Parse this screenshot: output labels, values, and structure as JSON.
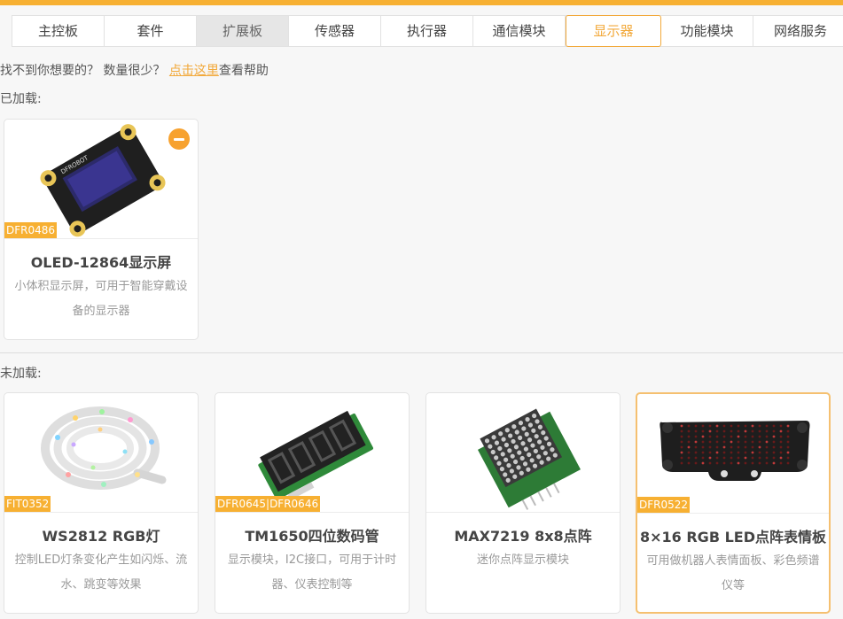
{
  "tabs": [
    {
      "label": "主控板"
    },
    {
      "label": "套件"
    },
    {
      "label": "扩展板"
    },
    {
      "label": "传感器"
    },
    {
      "label": "执行器"
    },
    {
      "label": "通信模块"
    },
    {
      "label": "显示器"
    },
    {
      "label": "功能模块"
    },
    {
      "label": "网络服务"
    }
  ],
  "help": {
    "prefix": "找不到你想要的？ 数量很少？ ",
    "link": "点击这里",
    "suffix": "查看帮助"
  },
  "loaded_label": "已加载:",
  "unloaded_label": "未加载:",
  "loaded": [
    {
      "code": "DFR0486",
      "name": "OLED-12864显示屏",
      "desc": "小体积显示屏，可用于智能穿戴设备的显示器"
    }
  ],
  "unloaded": [
    {
      "code": "FIT0352",
      "name": "WS2812 RGB灯",
      "desc": "控制LED灯条变化产生如闪烁、流水、跳变等效果"
    },
    {
      "code": "DFR0645|DFR0646",
      "name": "TM1650四位数码管",
      "desc": "显示模块，I2C接口，可用于计时器、仪表控制等"
    },
    {
      "code": "",
      "name": "MAX7219 8x8点阵",
      "desc": "迷你点阵显示模块"
    },
    {
      "code": "DFR0522",
      "name": "8×16 RGB LED点阵表情板",
      "desc": "可用做机器人表情面板、彩色频谱仪等"
    }
  ],
  "colors": {
    "accent": "#f7b032",
    "active_tab": "#f2a93b"
  }
}
